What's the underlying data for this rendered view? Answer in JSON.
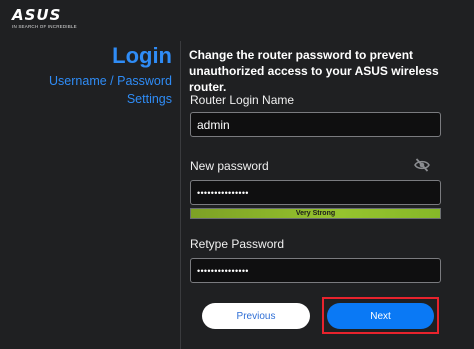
{
  "brand": {
    "name": "ASUS",
    "tagline": "IN SEARCH OF INCREDIBLE"
  },
  "sidebar": {
    "title": "Login",
    "subtitle_line1": "Username / Password",
    "subtitle_line2": "Settings"
  },
  "main": {
    "heading": "Change the router password to prevent unauthorized access to your ASUS wireless router.",
    "login_name": {
      "label": "Router Login Name",
      "value": "admin"
    },
    "new_password": {
      "label": "New password",
      "masked_value": "•••••••••••••••",
      "visibility_icon": "eye-slash-icon"
    },
    "strength": {
      "label": "Very Strong",
      "level": 1.0
    },
    "retype_password": {
      "label": "Retype Password",
      "masked_value": "•••••••••••••••"
    }
  },
  "buttons": {
    "previous": "Previous",
    "next": "Next"
  },
  "colors": {
    "accent": "#2f8cf6",
    "next_button": "#0a79f5",
    "strength_bar": "#8fbf2b",
    "highlight": "#e8232d",
    "background": "#1f2022"
  }
}
